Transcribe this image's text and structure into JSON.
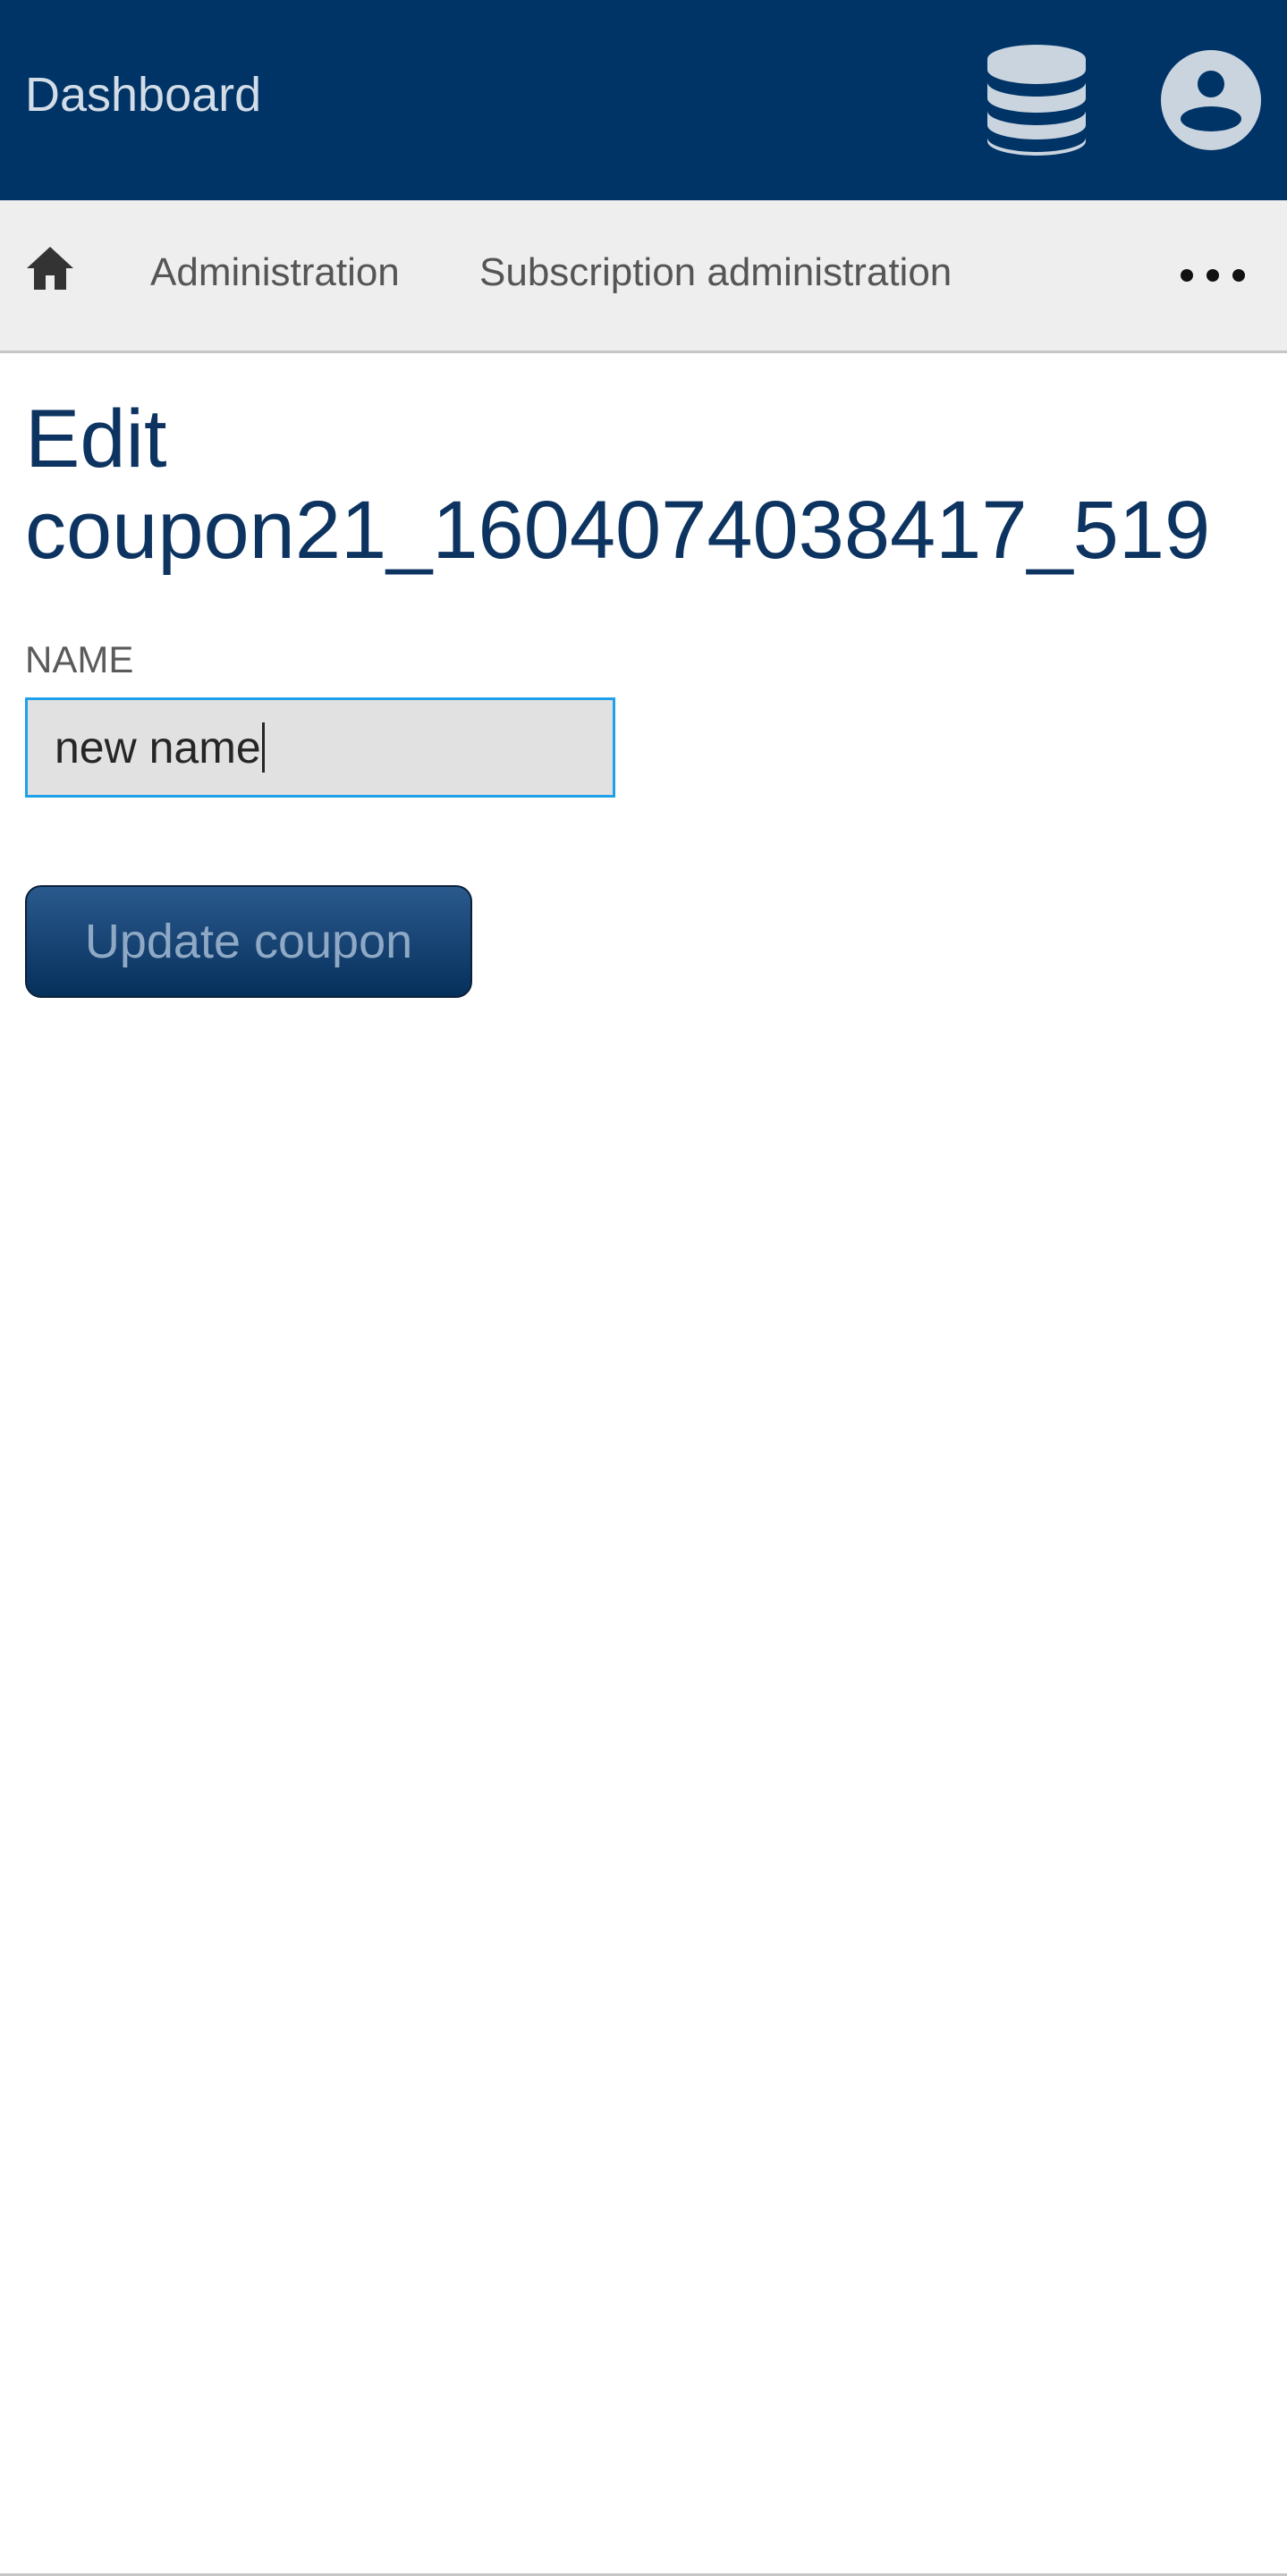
{
  "header": {
    "brand": "Dashboard",
    "background_color": "#003366",
    "icons": [
      "database-icon",
      "account-circle-icon"
    ]
  },
  "nav": {
    "home_icon": "home-icon",
    "items": [
      {
        "label": "Administration"
      },
      {
        "label": "Subscription administration"
      }
    ],
    "more_icon": "more-horizontal-icon"
  },
  "page": {
    "title": "Edit coupon21_1604074038417_519"
  },
  "form": {
    "name_label": "NAME",
    "name_value": "new name",
    "submit_label": "Update coupon"
  }
}
